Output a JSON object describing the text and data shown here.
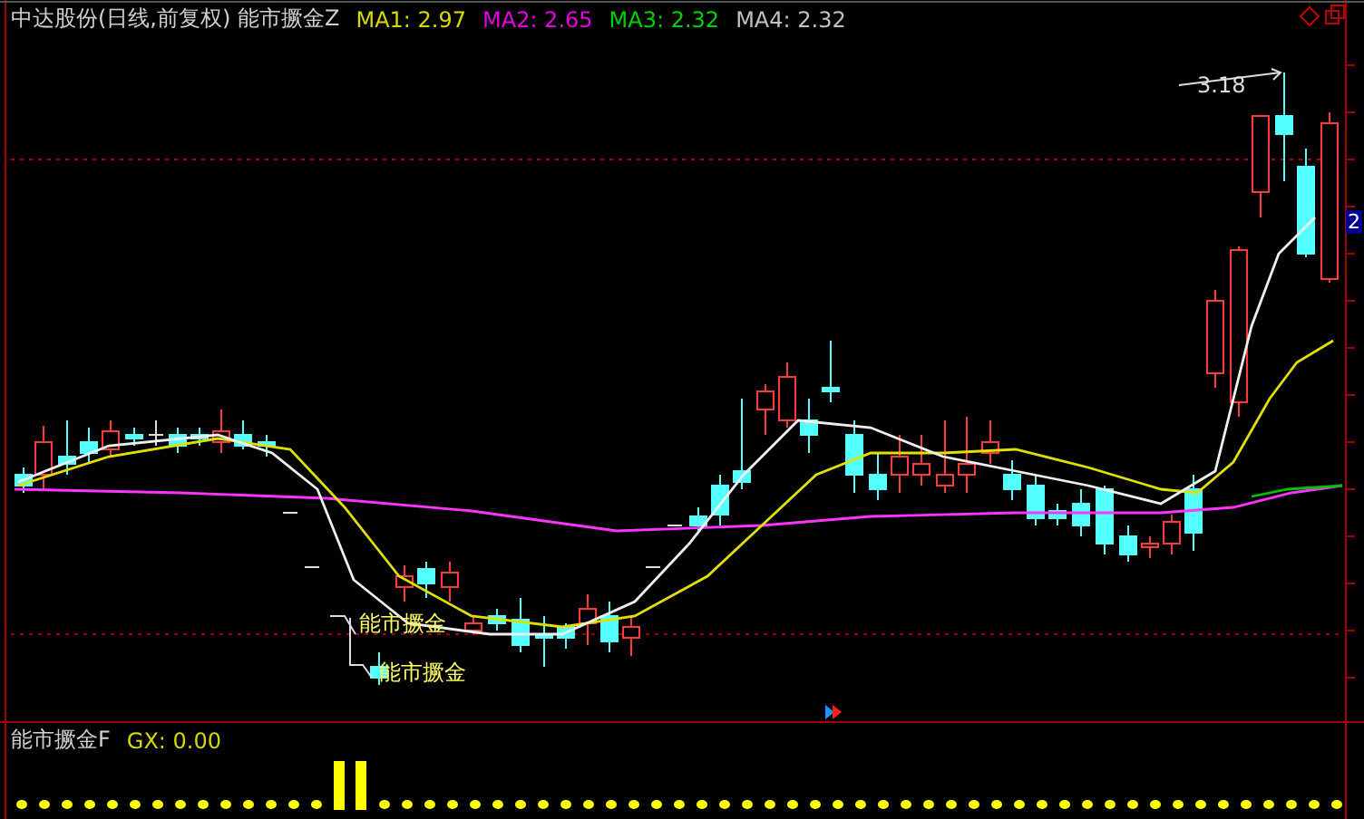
{
  "header": {
    "title": "中达股份(日线,前复权)",
    "indicator": "能市撅金Z",
    "ma": [
      {
        "label": "MA1: 2.97",
        "color": "#d8d800"
      },
      {
        "label": "MA2: 2.65",
        "color": "#e000e0"
      },
      {
        "label": "MA3: 2.32",
        "color": "#00d000"
      },
      {
        "label": "MA4: 2.32",
        "color": "#c0c0c0"
      }
    ]
  },
  "price_chart": {
    "peak_label": "3.18",
    "axis_label": "2",
    "signals": [
      "能市撅金",
      "能市撅金"
    ]
  },
  "sub_panel": {
    "title": "能市撅金F",
    "gx": "GX: 0.00"
  }
}
